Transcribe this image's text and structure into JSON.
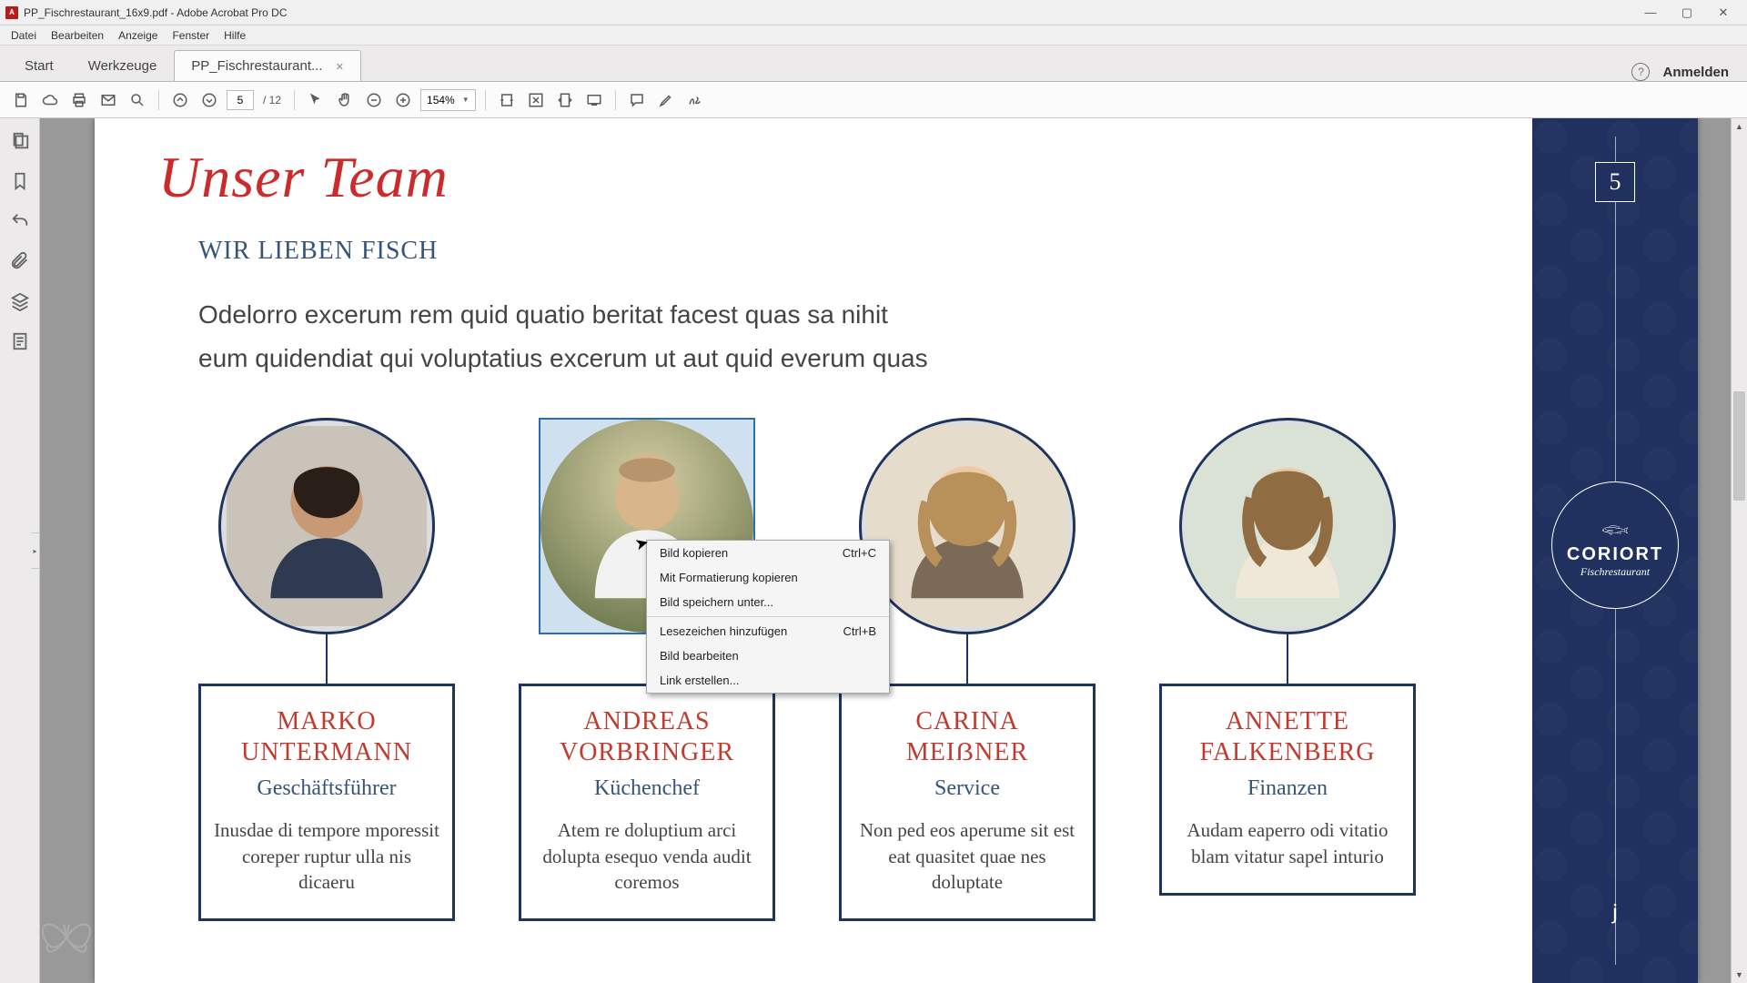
{
  "window": {
    "title": "PP_Fischrestaurant_16x9.pdf - Adobe Acrobat Pro DC"
  },
  "menu": {
    "items": [
      "Datei",
      "Bearbeiten",
      "Anzeige",
      "Fenster",
      "Hilfe"
    ]
  },
  "tabs": {
    "start": "Start",
    "tools": "Werkzeuge",
    "doc": "PP_Fischrestaurant...",
    "login": "Anmelden"
  },
  "toolbar": {
    "page_current": "5",
    "page_total": "/ 12",
    "zoom": "154%"
  },
  "doc": {
    "heading": "Unser Team",
    "subhead": "WIR LIEBEN FISCH",
    "body_l1": "Odelorro excerum rem quid quatio beritat facest quas sa nihit",
    "body_l2": "eum quidendiat qui voluptatius excerum ut aut quid everum quas",
    "page_number": "5",
    "brand_name": "CORIORT",
    "brand_sub": "Fischrestaurant",
    "members": [
      {
        "name": "MARKO UNTERMANN",
        "role": "Geschäftsführer",
        "desc": "Inusdae di tempore mporessit coreper ruptur ulla nis dicaeru"
      },
      {
        "name": "ANDREAS VORBRINGER",
        "role": "Küchenchef",
        "desc": "Atem re doluptium arci dolupta esequo venda audit coremos"
      },
      {
        "name": "CARINA MEIẞNER",
        "role": "Service",
        "desc": "Non ped eos aperume sit est eat quasitet quae nes doluptate"
      },
      {
        "name": "ANNETTE FALKENBERG",
        "role": "Finanzen",
        "desc": "Audam eaperro odi vitatio blam vitatur sapel inturio"
      }
    ]
  },
  "context_menu": {
    "copy_img": "Bild kopieren",
    "copy_img_sc": "Ctrl+C",
    "copy_fmt": "Mit Formatierung kopieren",
    "save_img": "Bild speichern unter...",
    "add_bm": "Lesezeichen hinzufügen",
    "add_bm_sc": "Ctrl+B",
    "edit_img": "Bild bearbeiten",
    "make_link": "Link erstellen..."
  }
}
